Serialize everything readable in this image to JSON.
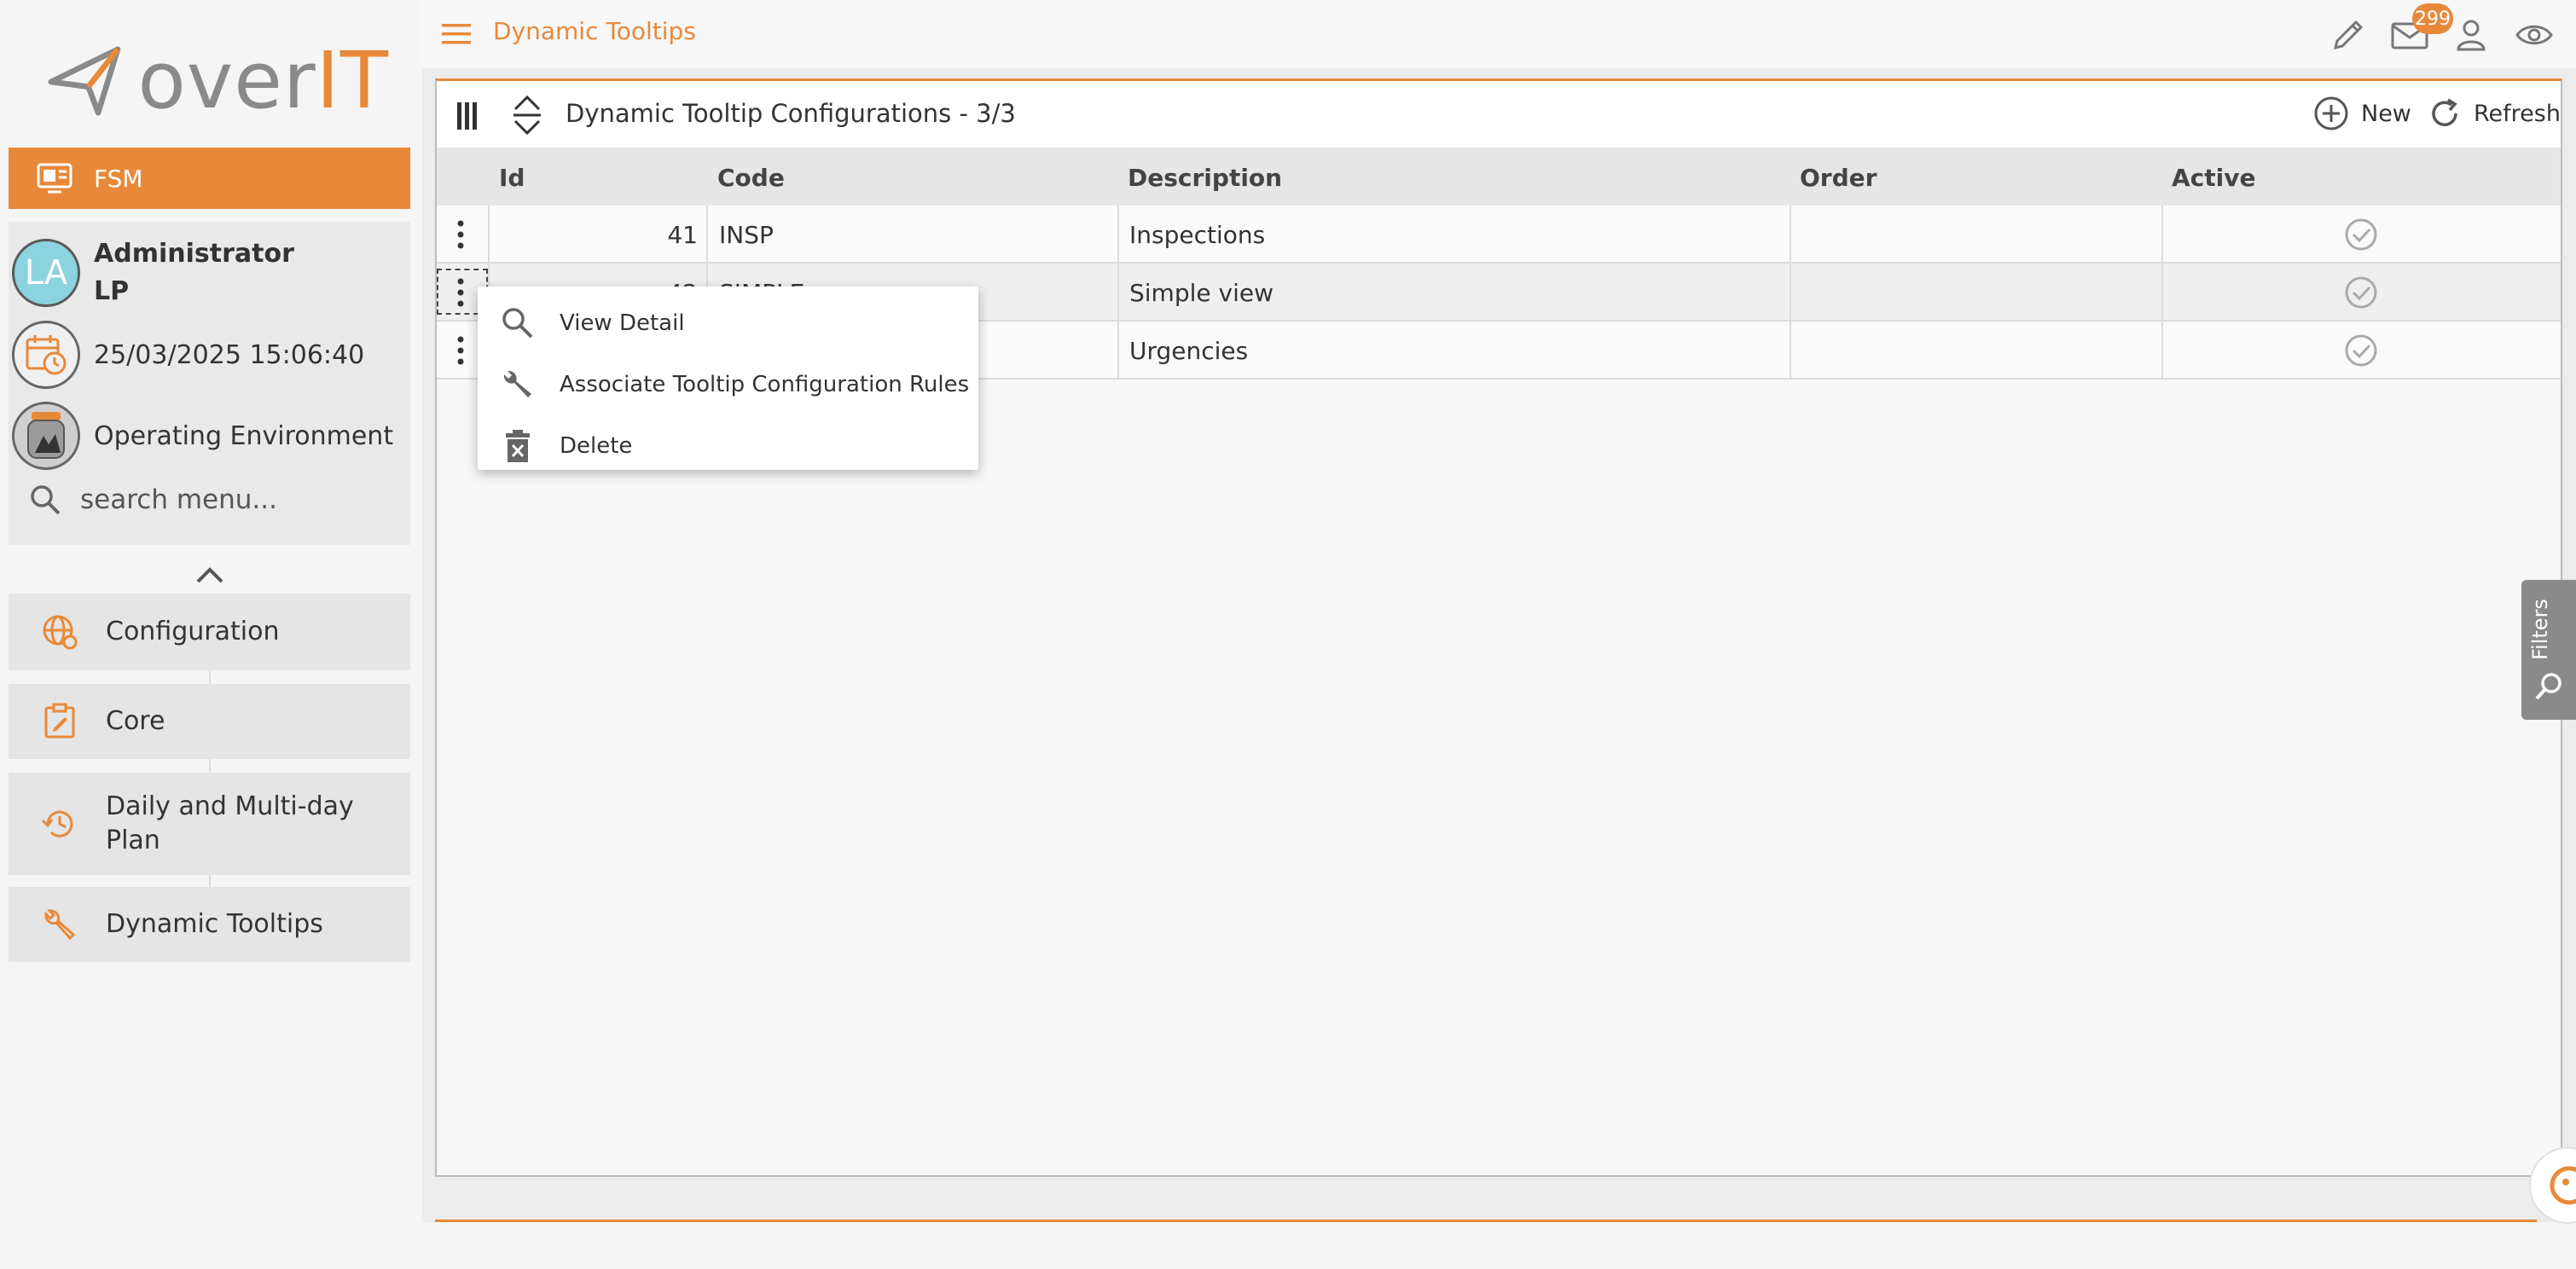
{
  "brand": {
    "logo_text_a": "over",
    "logo_text_b": "IT",
    "module_label": "FSM",
    "accent": "#e8893a"
  },
  "user": {
    "avatar_initials": "LA",
    "name": "Administrator",
    "code": "LP",
    "datetime": "25/03/2025 15:06:40",
    "environment": "Operating Environment"
  },
  "search": {
    "placeholder": "search menu..."
  },
  "sidebar": {
    "items": [
      {
        "label": "Configuration",
        "icon": "globe-gear-icon"
      },
      {
        "label": "Core",
        "icon": "clipboard-edit-icon"
      },
      {
        "label": "Daily and Multi-day Plan",
        "icon": "history-icon"
      },
      {
        "label": "Dynamic Tooltips",
        "icon": "wrench-icon"
      }
    ]
  },
  "header": {
    "breadcrumb": "Dynamic Tooltips",
    "mail_badge": "299"
  },
  "grid": {
    "title": "Dynamic Tooltip Configurations - 3/3",
    "new_label": "New",
    "refresh_label": "Refresh",
    "columns": [
      "Id",
      "Code",
      "Description",
      "Order",
      "Active"
    ],
    "rows": [
      {
        "id": "41",
        "code": "INSP",
        "description": "Inspections",
        "order": "",
        "active": true
      },
      {
        "id": "42",
        "code": "SIMPLE",
        "description": "Simple view",
        "order": "",
        "active": true
      },
      {
        "id": "",
        "code": "",
        "description": "Urgencies",
        "order": "",
        "active": true
      }
    ]
  },
  "context_menu": {
    "items": [
      {
        "label": "View Detail",
        "icon": "search-icon"
      },
      {
        "label": "Associate Tooltip Configuration Rules",
        "icon": "wrench-icon"
      },
      {
        "label": "Delete",
        "icon": "trash-icon"
      }
    ]
  },
  "filters_tab": {
    "label": "Filters"
  }
}
